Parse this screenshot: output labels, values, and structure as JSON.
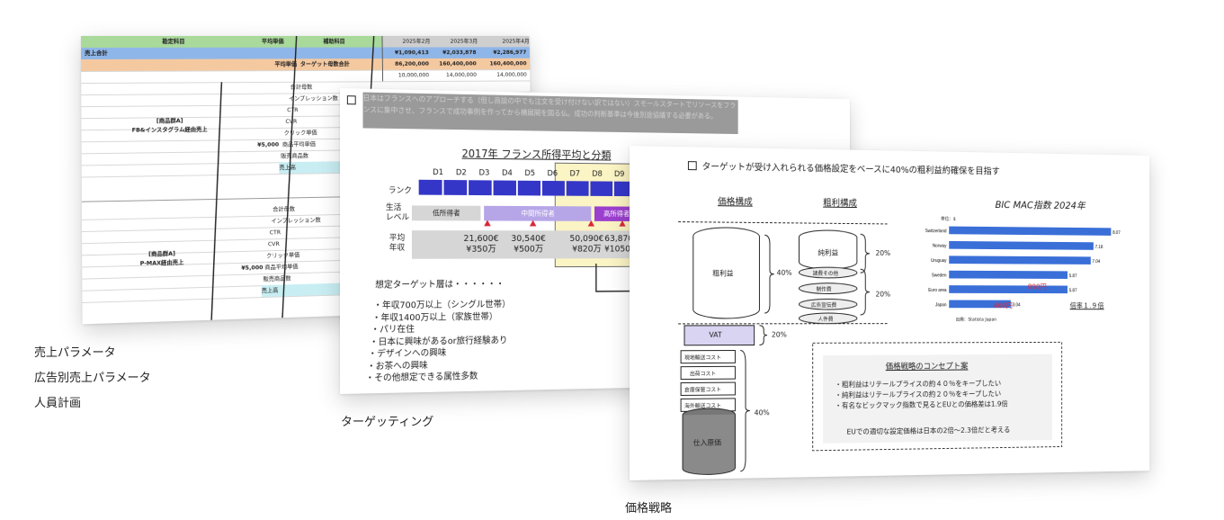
{
  "sheet": {
    "headers": [
      "勘定科目",
      "平均単価",
      "補助科目",
      "2025年2月",
      "2025年3月",
      "2025年4月"
    ],
    "total_row": {
      "label": "売上合計",
      "values": [
        "¥1,090,413",
        "¥2,033,878",
        "¥2,286,977"
      ]
    },
    "avg_row": {
      "label1": "平均単価",
      "label2": "ターゲット母数合計",
      "values": [
        "86,200,000",
        "160,400,000",
        "160,400,000"
      ]
    },
    "row4_values": [
      "10,000,000",
      "14,000,000",
      "14,000,000"
    ],
    "group1": {
      "title1": "[商品群A]",
      "title2": "FB&インスタグラム経由売上",
      "price": "¥5,000",
      "items": [
        "合計母数",
        "インプレッション数",
        "CTR",
        "CVR",
        "クリック単価",
        "商品平均単価",
        "販売商品数",
        "売上高"
      ]
    },
    "group2": {
      "title1": "[商品群A]",
      "title2": "P-MAX経由売上",
      "price": "¥5,000",
      "items": [
        "合計母数",
        "インプレッション数",
        "CTR",
        "CVR",
        "クリック単価",
        "商品平均単価",
        "販売商品数",
        "売上高"
      ]
    }
  },
  "captions": {
    "left": [
      "売上パラメータ",
      "広告別売上パラメータ",
      "人員計画"
    ],
    "targeting": "ターゲッティング",
    "pricing": "価格戦略"
  },
  "targeting": {
    "top_text": "日本はフランスへのアプローチする（但し商談の中でも注文を受け付けない訳ではない）スモールスタートでリソースをフランスに集中させ、フランスで成功事例を作ってから横展開を図る仏。成功の判断基準は今後別途協議する必要がある。",
    "chart_title": "2017年 フランス所得平均と分類",
    "deciles": [
      "D1",
      "D2",
      "D3",
      "D4",
      "D5",
      "D6",
      "D7",
      "D8",
      "D9"
    ],
    "rank_label": "ランク",
    "life_label": [
      "生活",
      "レベル"
    ],
    "levels": [
      "低所得者",
      "中間所得者",
      "高所得者"
    ],
    "income_label": [
      "平均",
      "年収"
    ],
    "incomes": [
      {
        "eur": "21,600€",
        "jpy": "¥350万"
      },
      {
        "eur": "30,540€",
        "jpy": "¥500万"
      },
      {
        "eur": "50,090€",
        "jpy": "¥820万"
      },
      {
        "eur": "63,870€",
        "jpy": "¥1050万"
      }
    ],
    "persona_title": "想定ターゲット層は・・・・・・",
    "persona": [
      "年収700万以上（シングル世帯）",
      "年収1400万以上（家族世帯）",
      "パリ在住",
      "日本に興味があるor旅行経験あり",
      "デザインへの興味",
      "お茶への興味",
      "その他想定できる属性多数"
    ]
  },
  "pricing": {
    "headline": "ターゲットが受け入れられる価格設定をベースに40%の粗利益約確保を目指す",
    "col1_title": "価格構成",
    "col2_title": "粗利構成",
    "col3_title": "BIC MAC指数 2024年",
    "gross": "粗利益",
    "net": "純利益",
    "cost_items": [
      "諸費その他",
      "制作費",
      "広告宣伝費",
      "人件費"
    ],
    "vat": "VAT",
    "logistics": [
      "現地輸送コスト",
      "出荷コスト",
      "倉庫保管コスト",
      "海外輸送コスト"
    ],
    "purchase": "仕入原価",
    "percents": {
      "gross": "40%",
      "net": "20%",
      "costs": "20%",
      "vat": "20%",
      "purchase": "40%"
    },
    "bigmac_unit": "単位：$",
    "bigmac": [
      {
        "country": "Switzerland",
        "value": 8.07
      },
      {
        "country": "Norway",
        "value": 7.18
      },
      {
        "country": "Uruguay",
        "value": 7.04
      },
      {
        "country": "Sweden",
        "value": 5.87
      },
      {
        "country": "Euro area",
        "value": 5.87
      },
      {
        "country": "Japan",
        "value": 3.04
      }
    ],
    "bigmac_labels": [
      "8.07",
      "7.18",
      "7.04",
      "5.87",
      "5.87",
      "3.04"
    ],
    "yen_eu": "890円",
    "yen_jp": "460円",
    "ratio": "倍率１.９倍",
    "source": "出典：Statista Japan",
    "concept_title": "価格戦略のコンセプト案",
    "concept": [
      "粗利益はリテールプライスの約４０％をキープしたい",
      "純利益はリテールプライスの約２０％をキープしたい",
      "有名なビックマック指数で見るとEUとの価格差は1.9倍"
    ],
    "concept_footer": "EUでの適切な設定価格は日本の2倍～2.3倍だと考える"
  }
}
